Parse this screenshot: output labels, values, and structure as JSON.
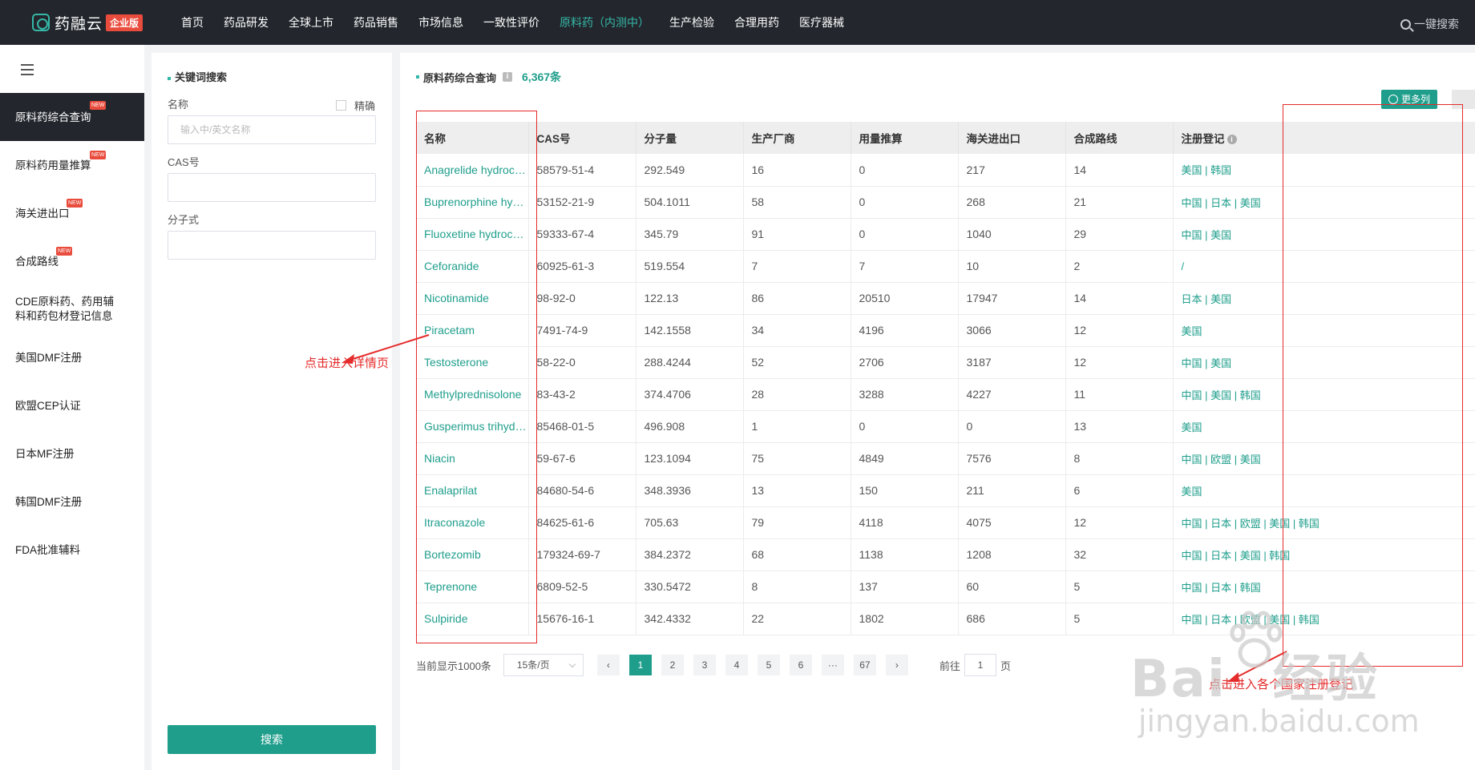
{
  "topbar": {
    "logo_name": "药融云",
    "logo_badge": "企业版",
    "nav": [
      "首页",
      "药品研发",
      "全球上市",
      "药品销售",
      "市场信息",
      "一致性评价",
      "原料药（内测中）",
      "生产检验",
      "合理用药",
      "医疗器械"
    ],
    "active_nav_index": 6,
    "search_label": "一键搜索"
  },
  "sidebar": {
    "items": [
      {
        "label": "原料药综合查询",
        "new": true
      },
      {
        "label": "原料药用量推算",
        "new": true
      },
      {
        "label": "海关进出口",
        "new": true
      },
      {
        "label": "合成路线",
        "new": true
      },
      {
        "label": "CDE原料药、药用辅料和药包材登记信息",
        "new": false
      },
      {
        "label": "美国DMF注册",
        "new": false
      },
      {
        "label": "欧盟CEP认证",
        "new": false
      },
      {
        "label": "日本MF注册",
        "new": false
      },
      {
        "label": "韩国DMF注册",
        "new": false
      },
      {
        "label": "FDA批准辅料",
        "new": false
      }
    ],
    "new_tag": "NEW"
  },
  "filter": {
    "title": "关键词搜索",
    "name_label": "名称",
    "exact_label": "精确",
    "name_placeholder": "输入中/英文名称",
    "cas_label": "CAS号",
    "formula_label": "分子式",
    "search_button": "搜索"
  },
  "main": {
    "title": "原料药综合查询",
    "info": "i",
    "count": "6,367条",
    "more_columns": "更多列",
    "columns": [
      "名称",
      "CAS号",
      "分子量",
      "生产厂商",
      "用量推算",
      "海关进出口",
      "合成路线",
      "注册登记"
    ],
    "rows": [
      [
        "Anagrelide hydrochloride",
        "58579-51-4",
        "292.549",
        "16",
        "0",
        "217",
        "14",
        "美国 | 韩国"
      ],
      [
        "Buprenorphine hydrochloride",
        "53152-21-9",
        "504.1011",
        "58",
        "0",
        "268",
        "21",
        "中国 | 日本 | 美国"
      ],
      [
        "Fluoxetine hydrochloride",
        "59333-67-4",
        "345.79",
        "91",
        "0",
        "1040",
        "29",
        "中国 | 美国"
      ],
      [
        "Ceforanide",
        "60925-61-3",
        "519.554",
        "7",
        "7",
        "10",
        "2",
        "/"
      ],
      [
        "Nicotinamide",
        "98-92-0",
        "122.13",
        "86",
        "20510",
        "17947",
        "14",
        "日本 | 美国"
      ],
      [
        "Piracetam",
        "7491-74-9",
        "142.1558",
        "34",
        "4196",
        "3066",
        "12",
        "美国"
      ],
      [
        "Testosterone",
        "58-22-0",
        "288.4244",
        "52",
        "2706",
        "3187",
        "12",
        "中国 | 美国"
      ],
      [
        "Methylprednisolone",
        "83-43-2",
        "374.4706",
        "28",
        "3288",
        "4227",
        "11",
        "中国 | 美国 | 韩国"
      ],
      [
        "Gusperimus trihydrochloride",
        "85468-01-5",
        "496.908",
        "1",
        "0",
        "0",
        "13",
        "美国"
      ],
      [
        "Niacin",
        "59-67-6",
        "123.1094",
        "75",
        "4849",
        "7576",
        "8",
        "中国 | 欧盟 | 美国"
      ],
      [
        "Enalaprilat",
        "84680-54-6",
        "348.3936",
        "13",
        "150",
        "211",
        "6",
        "美国"
      ],
      [
        "Itraconazole",
        "84625-61-6",
        "705.63",
        "79",
        "4118",
        "4075",
        "12",
        "中国 | 日本 | 欧盟 | 美国 | 韩国"
      ],
      [
        "Bortezomib",
        "179324-69-7",
        "384.2372",
        "68",
        "1138",
        "1208",
        "32",
        "中国 | 日本 | 美国 | 韩国"
      ],
      [
        "Teprenone",
        "6809-52-5",
        "330.5472",
        "8",
        "137",
        "60",
        "5",
        "中国 | 日本 | 韩国"
      ],
      [
        "Sulpiride",
        "15676-16-1",
        "342.4332",
        "22",
        "1802",
        "686",
        "5",
        "中国 | 日本 | 欧盟 | 美国 | 韩国"
      ]
    ]
  },
  "pager": {
    "total_text": "当前显示1000条",
    "page_size": "15条/页",
    "prev": "‹",
    "pages": [
      "1",
      "2",
      "3",
      "4",
      "5",
      "6",
      "···",
      "67"
    ],
    "next": "›",
    "goto_label": "前往",
    "goto_value": "1",
    "goto_suffix": "页"
  },
  "annotations": {
    "left_text": "点击进入详情页",
    "right_text": "点击进入各个国家注册登记",
    "color": "#e52b2b"
  },
  "watermark": {
    "brand": "Bai",
    "brand2": "经验",
    "url": "jingyan.baidu.com"
  },
  "colors": {
    "accent": "#1f9e8c",
    "topbar": "#23272d",
    "badge": "#e94b3c"
  }
}
